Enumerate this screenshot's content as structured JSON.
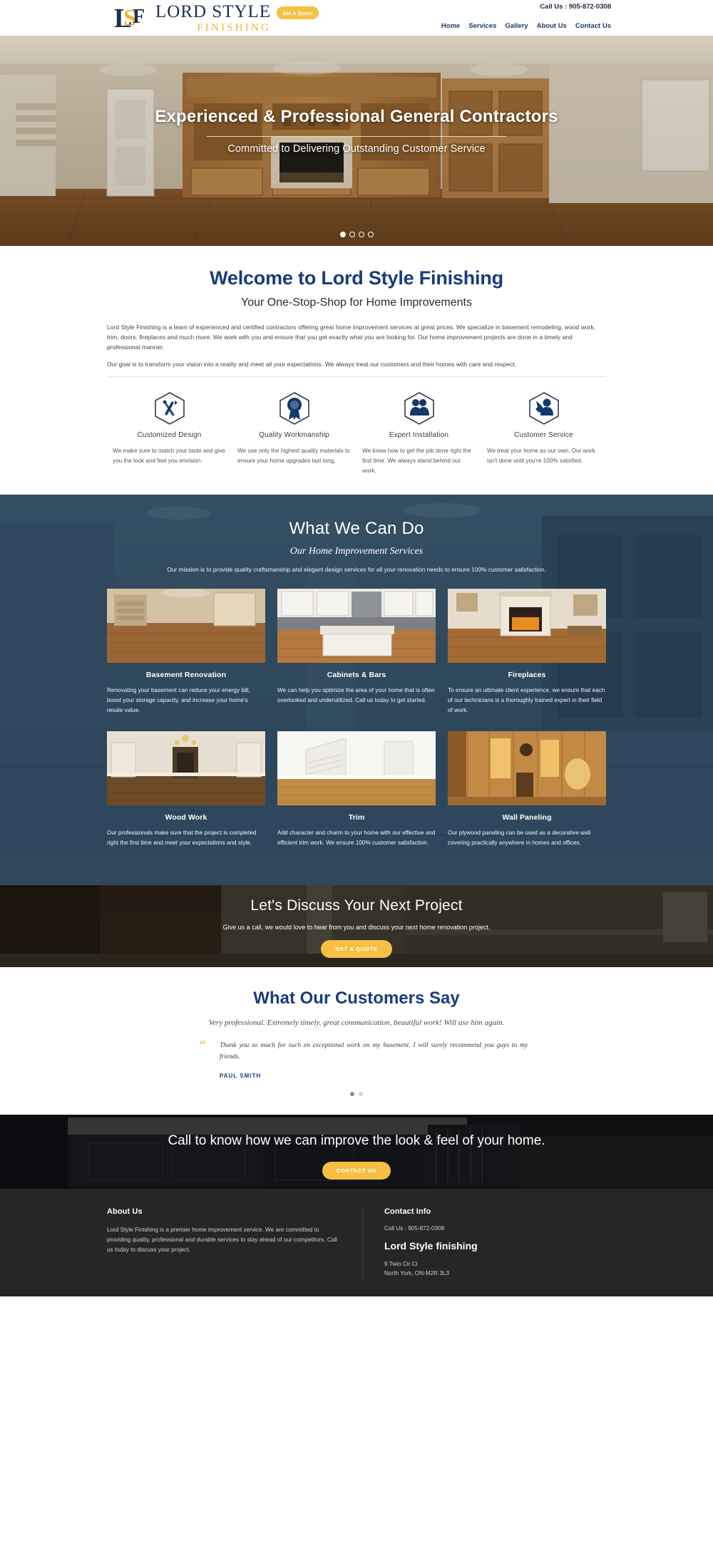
{
  "brand": {
    "name_line1": "LORD STYLE",
    "name_line2": "FINISHING",
    "accent_yellow": "#f5c044",
    "accent_navy": "#1b3b7a"
  },
  "header": {
    "quote_button": "Get A Quote",
    "phone_label": "Call Us : 905-872-0308",
    "nav": [
      {
        "label": "Home"
      },
      {
        "label": "Services"
      },
      {
        "label": "Gallery"
      },
      {
        "label": "About Us"
      },
      {
        "label": "Contact Us"
      }
    ]
  },
  "hero": {
    "title": "Experienced & Professional General Contractors",
    "subtitle": "Committed to Delivering Outstanding Customer Service",
    "slide_count": 4,
    "active_slide": 1
  },
  "welcome": {
    "title": "Welcome to Lord Style Finishing",
    "subtitle": "Your One-Stop-Shop for Home Improvements",
    "paragraphs": [
      "Lord Style Finishing is a team of experienced and certified contractors offering great home improvement services at great prices. We specialize in basement remodeling, wood work, trim, doors, fireplaces and much more. We work with you and ensure that you get exactly what you are looking for. Our home improvement projects are done in a timely and professional manner.",
      "Our goal is to transform your vision into a reality and meet all your expectations. We always treat our customers and their homes with care and respect."
    ],
    "features": [
      {
        "icon": "drafting-tools-icon",
        "title": "Customized Design",
        "desc": "We make sure to match your taste and give you the look and feel you envision."
      },
      {
        "icon": "award-ribbon-icon",
        "title": "Quality Workmanship",
        "desc": "We use only the highest quality materials to ensure your home upgrades last long."
      },
      {
        "icon": "team-people-icon",
        "title": "Expert Installation",
        "desc": "We know how to get the job done right the first time. We always stand behind our work."
      },
      {
        "icon": "headset-support-icon",
        "title": "Customer Service",
        "desc": "We treat your home as our own. Our work isn't done until you're 100% satisfied."
      }
    ]
  },
  "services": {
    "title": "What We Can Do",
    "subtitle": "Our Home Improvement Services",
    "mission": "Our mission is to provide quality craftsmanship and elegant design services for all your renovation needs to ensure 100% customer satisfaction.",
    "cards": [
      {
        "name": "Basement Renovation",
        "desc": "Renovating your basement can reduce your energy bill, boost your storage capacity, and increase your home's resale value."
      },
      {
        "name": "Cabinets & Bars",
        "desc": "We can help you optimize the area of your home that is often overlooked and underutilized. Call us today to get started."
      },
      {
        "name": "Fireplaces",
        "desc": "To ensure an ultimate client experience, we ensure that each of our technicians is a thoroughly trained expert in their field of work."
      },
      {
        "name": "Wood Work",
        "desc": "Our professionals make sure that the project is completed right the first time and meet your expectations and style."
      },
      {
        "name": "Trim",
        "desc": "Add character and charm to your home with our effective and efficient trim work. We ensure 100% customer satisfaction."
      },
      {
        "name": "Wall Paneling",
        "desc": "Our plywood paneling can be used as a decorative wall covering practically anywhere in homes and offices."
      }
    ]
  },
  "discuss": {
    "title": "Let's Discuss Your Next Project",
    "text": "Give us a call, we would love to hear from you and discuss your next home renovation project.",
    "button": "GET A QUOTE"
  },
  "testimonials": {
    "title": "What Our Customers Say",
    "lead": "Very professional. Extremely timely, great communication, beautiful work! Will use him again.",
    "quote_mark": "“",
    "quote": "Thank you so much for such en exceptional work on my basement. I will surely recommend you guys to my friends.",
    "author": "PAUL SMITH",
    "slide_count": 2,
    "active_slide": 0
  },
  "bottom_cta": {
    "title": "Call to know how we can improve the look & feel of your home.",
    "button": "CONTACT US"
  },
  "footer": {
    "about_title": "About Us",
    "about_text": "Lord Style Finishing is a premier home improvement service. We are committed to providing quality, professional and durable services to stay ahead of our competitors. Call us today to discuss your project.",
    "contact_title": "Contact Info",
    "contact_phone": "Call Us : 905-872-0308",
    "business_name": "Lord Style finishing",
    "address_line1": "9 Twin Cir Ct",
    "address_line2": "North York, ON-M2R 3L3"
  }
}
